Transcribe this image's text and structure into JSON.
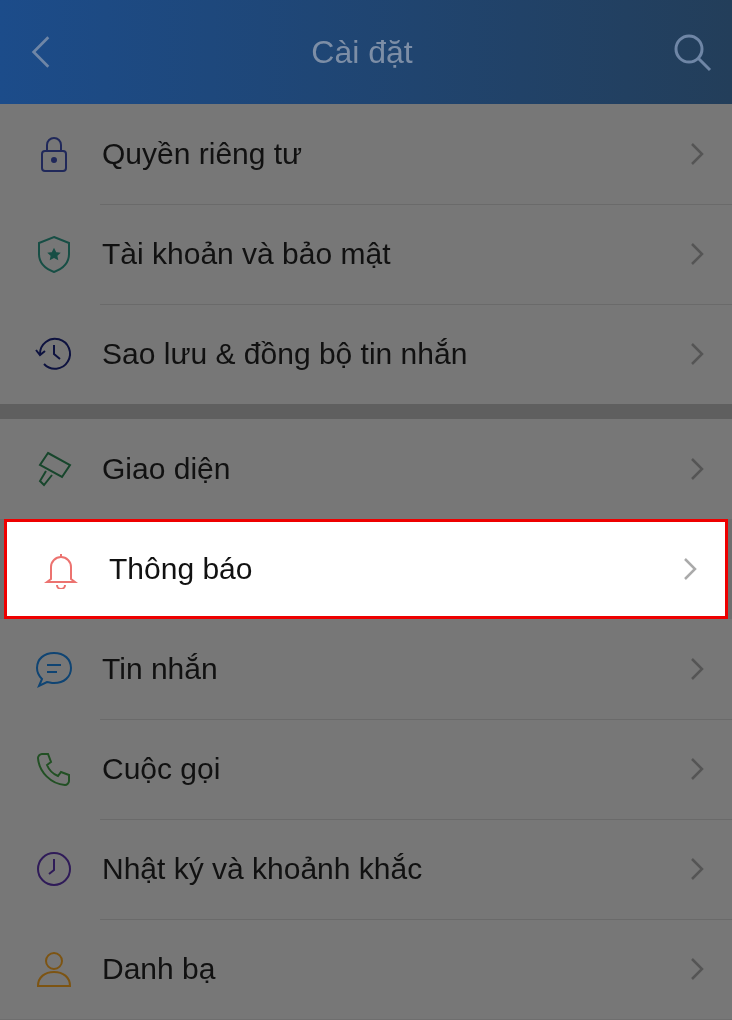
{
  "header": {
    "title": "Cài đặt"
  },
  "sections": [
    {
      "items": [
        {
          "label": "Quyền riêng tư",
          "kind": "lock",
          "highlighted": false
        },
        {
          "label": "Tài khoản và bảo mật",
          "kind": "shield",
          "highlighted": false
        },
        {
          "label": "Sao lưu & đồng bộ tin nhắn",
          "kind": "history",
          "highlighted": false
        }
      ]
    },
    {
      "items": [
        {
          "label": "Giao diện",
          "kind": "brush",
          "highlighted": false
        },
        {
          "label": "Thông báo",
          "kind": "bell",
          "highlighted": true
        },
        {
          "label": "Tin nhắn",
          "kind": "chat",
          "highlighted": false
        },
        {
          "label": "Cuộc gọi",
          "kind": "phone",
          "highlighted": false
        },
        {
          "label": "Nhật ký và khoảnh khắc",
          "kind": "clock",
          "highlighted": false
        },
        {
          "label": "Danh bạ",
          "kind": "person",
          "highlighted": false
        }
      ]
    }
  ]
}
